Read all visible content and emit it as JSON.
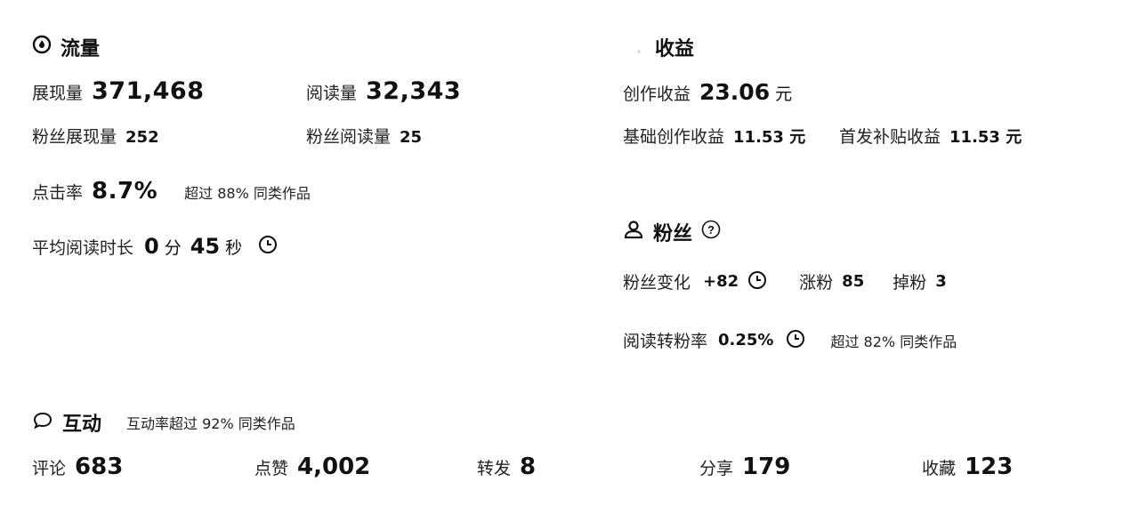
{
  "traffic": {
    "title": "流量",
    "impressions_label": "展现量",
    "impressions_value": "371,468",
    "reads_label": "阅读量",
    "reads_value": "32,343",
    "fan_impressions_label": "粉丝展现量",
    "fan_impressions_value": "252",
    "fan_reads_label": "粉丝阅读量",
    "fan_reads_value": "25",
    "ctr_label": "点击率",
    "ctr_value": "8.7%",
    "ctr_note": "超过 88% 同类作品",
    "avg_read_label": "平均阅读时长",
    "avg_read_min": "0",
    "avg_read_min_unit": "分",
    "avg_read_sec": "45",
    "avg_read_sec_unit": "秒"
  },
  "earnings": {
    "title": "收益",
    "creation_label": "创作收益",
    "creation_value": "23.06",
    "creation_unit": "元",
    "base_label": "基础创作收益",
    "base_value": "11.53 元",
    "first_pub_label": "首发补贴收益",
    "first_pub_value": "11.53 元"
  },
  "fans": {
    "title": "粉丝",
    "change_label": "粉丝变化",
    "change_value": "+82",
    "gain_label": "涨粉",
    "gain_value": "85",
    "loss_label": "掉粉",
    "loss_value": "3",
    "conv_label": "阅读转粉率",
    "conv_value": "0.25%",
    "conv_note": "超过 82% 同类作品"
  },
  "interaction": {
    "title": "互动",
    "note": "互动率超过 92% 同类作品",
    "comments_label": "评论",
    "comments_value": "683",
    "likes_label": "点赞",
    "likes_value": "4,002",
    "reposts_label": "转发",
    "reposts_value": "8",
    "shares_label": "分享",
    "shares_value": "179",
    "favorites_label": "收藏",
    "favorites_value": "123"
  }
}
